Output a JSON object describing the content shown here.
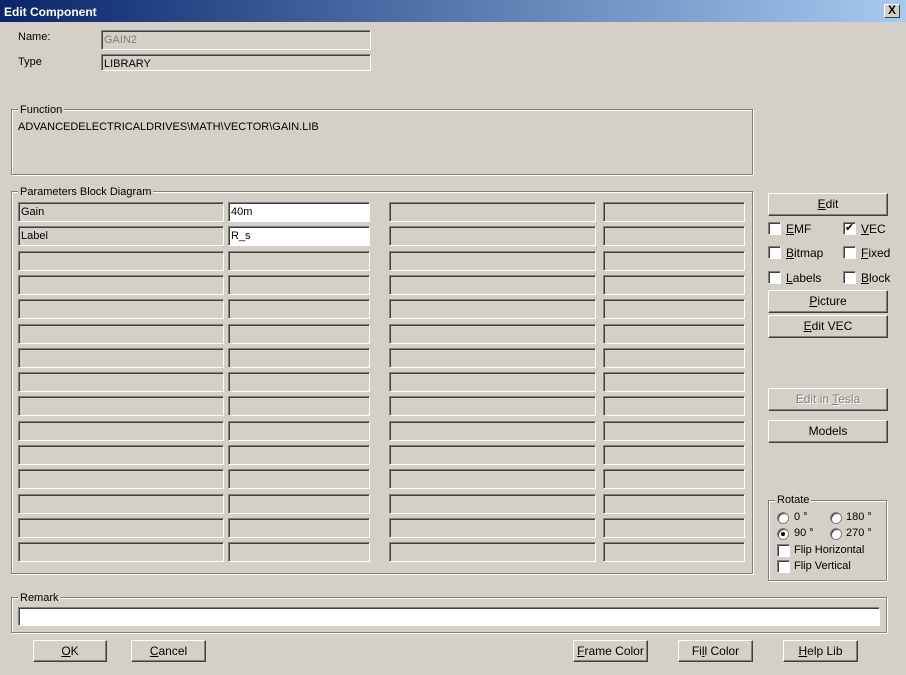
{
  "window": {
    "title": "Edit Component",
    "close_glyph": "X"
  },
  "name_row": {
    "label": "Name:",
    "value": "GAIN2"
  },
  "type_row": {
    "label": "Type",
    "value": "LIBRARY"
  },
  "function_group": {
    "legend": "Function",
    "text": "ADVANCEDELECTRICALDRIVES\\MATH\\VECTOR\\GAIN.LIB"
  },
  "params_group": {
    "legend": "Parameters Block Diagram",
    "rows": [
      {
        "name": "Gain",
        "value": "40m"
      },
      {
        "name": "Label",
        "value": "R_s"
      },
      {
        "name": "",
        "value": ""
      },
      {
        "name": "",
        "value": ""
      },
      {
        "name": "",
        "value": ""
      },
      {
        "name": "",
        "value": ""
      },
      {
        "name": "",
        "value": ""
      },
      {
        "name": "",
        "value": ""
      },
      {
        "name": "",
        "value": ""
      },
      {
        "name": "",
        "value": ""
      },
      {
        "name": "",
        "value": ""
      },
      {
        "name": "",
        "value": ""
      },
      {
        "name": "",
        "value": ""
      },
      {
        "name": "",
        "value": ""
      },
      {
        "name": "",
        "value": ""
      }
    ]
  },
  "side": {
    "edit": {
      "pre": "",
      "key": "E",
      "post": "dit"
    },
    "picture": {
      "pre": "",
      "key": "P",
      "post": "icture"
    },
    "edit_vec": {
      "pre": "",
      "key": "E",
      "post": "dit VEC"
    },
    "edit_tesla": {
      "pre": "Edit in ",
      "key": "T",
      "post": "esla"
    },
    "models": "Models",
    "checks": {
      "emf": {
        "pre": "",
        "key": "E",
        "post": "MF",
        "checked": false
      },
      "vec": {
        "pre": "",
        "key": "V",
        "post": "EC",
        "checked": true
      },
      "bitmap": {
        "pre": "",
        "key": "B",
        "post": "itmap",
        "checked": false
      },
      "fixed": {
        "pre": "",
        "key": "F",
        "post": "ixed",
        "checked": false
      },
      "labels": {
        "pre": "",
        "key": "L",
        "post": "abels",
        "checked": false
      },
      "block": {
        "pre": "",
        "key": "B",
        "post": "lock",
        "checked": false
      }
    },
    "check_glyph": "✔"
  },
  "rotate": {
    "legend": "Rotate",
    "opt0": "0 °",
    "opt180": "180 °",
    "opt90": "90 °",
    "opt270": "270 °",
    "selected": "90",
    "flip_h": "Flip Horizontal",
    "flip_v": "Flip Vertical"
  },
  "remark": {
    "legend": "Remark",
    "value": ""
  },
  "footer": {
    "ok": {
      "pre": "",
      "key": "O",
      "post": "K"
    },
    "cancel": {
      "pre": "",
      "key": "C",
      "post": "ancel"
    },
    "frame_color": {
      "pre": "",
      "key": "F",
      "post": "rame Color"
    },
    "fill_color": {
      "pre": "Fi",
      "key": "l",
      "post": "l Color"
    },
    "help_lib": {
      "pre": "",
      "key": "H",
      "post": "elp Lib"
    }
  }
}
